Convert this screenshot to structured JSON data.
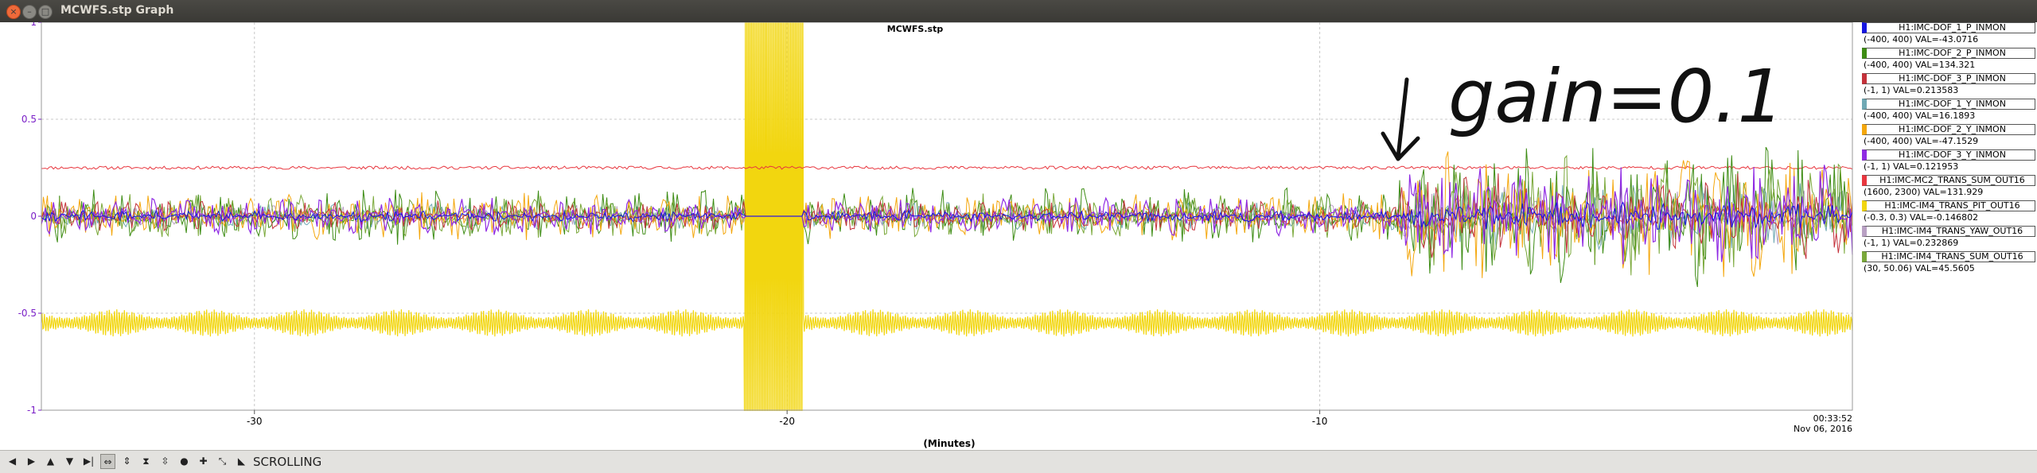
{
  "window": {
    "title": "MCWFS.stp Graph",
    "close_glyph": "×",
    "minimize_glyph": "–",
    "maximize_glyph": "□"
  },
  "chart_data": {
    "type": "line",
    "title": "MCWFS.stp",
    "xlabel": "(Minutes)",
    "ylabel": "",
    "xlim": [
      -34,
      0
    ],
    "ylim": [
      -1,
      1
    ],
    "x_ticks": [
      {
        "value": -30,
        "label": "-30"
      },
      {
        "value": -20,
        "label": "-20"
      },
      {
        "value": -10,
        "label": "-10"
      }
    ],
    "x_end_label": [
      "00:33:52",
      "Nov 06, 2016"
    ],
    "y_ticks": [
      {
        "value": 1,
        "label": "1"
      },
      {
        "value": 0.5,
        "label": "0.5"
      },
      {
        "value": 0,
        "label": "0"
      },
      {
        "value": -0.5,
        "label": "-0.5"
      },
      {
        "value": -1,
        "label": "-1"
      }
    ],
    "grid": true,
    "legend_position": "right",
    "annotation": {
      "text": "gain=0.1",
      "arrow": "down",
      "kind": "handwritten"
    },
    "series": [
      {
        "name": "H1:IMC-DOF_1_P_INMON",
        "range": "(-400, 400)",
        "value_text": "(-400, 400) VAL=-43.0716",
        "color": "#1515e0"
      },
      {
        "name": "H1:IMC-DOF_2_P_INMON",
        "range": "(-400, 400)",
        "value_text": "(-400, 400) VAL=134.321",
        "color": "#3d8c14"
      },
      {
        "name": "H1:IMC-DOF_3_P_INMON",
        "range": "(-1, 1)",
        "value_text": "(-1, 1) VAL=0.213583",
        "color": "#c4313a"
      },
      {
        "name": "H1:IMC-DOF_1_Y_INMON",
        "range": "(-400, 400)",
        "value_text": "(-400, 400) VAL=16.1893",
        "color": "#6fa8b4"
      },
      {
        "name": "H1:IMC-DOF_2_Y_INMON",
        "range": "(-400, 400)",
        "value_text": "(-400, 400) VAL=-47.1529",
        "color": "#f4a70d"
      },
      {
        "name": "H1:IMC-DOF_3_Y_INMON",
        "range": "(-1, 1)",
        "value_text": "(-1, 1) VAL=0.121953",
        "color": "#8f2ae3"
      },
      {
        "name": "H1:IMC-MC2_TRANS_SUM_OUT16",
        "range": "(1600, 2300)",
        "value_text": "(1600, 2300) VAL=131.929",
        "color": "#e8363e"
      },
      {
        "name": "H1:IMC-IM4_TRANS_PIT_OUT16",
        "range": "(-0.3, 0.3)",
        "value_text": "(-0.3, 0.3) VAL=-0.146802",
        "color": "#f2d60f"
      },
      {
        "name": "H1:IMC-IM4_TRANS_YAW_OUT16",
        "range": "(-1, 1)",
        "value_text": "(-1, 1) VAL=0.232869",
        "color": "#b9a1c4"
      },
      {
        "name": "H1:IMC-IM4_TRANS_SUM_OUT16",
        "range": "(30, 50.06)",
        "value_text": "(30, 50.06) VAL=45.5605",
        "color": "#7aa83a"
      }
    ],
    "approx_envelopes": {
      "gap_minutes": [
        -20.8,
        -19.7
      ],
      "gain_change_minute": -8.5,
      "mc2_trans_level": 0.25,
      "im4_pit_center": -0.55,
      "im4_pit_amplitude": 0.07,
      "noise_amp_before": 0.12,
      "noise_amp_after": 0.32
    }
  },
  "toolbar": {
    "buttons": [
      "◀",
      "▶",
      "▲",
      "▼",
      "▶|",
      "⇔",
      "⇕",
      "⧗",
      "⇳",
      "●",
      "✚",
      "⤡",
      "◣"
    ],
    "mode_label": "SCROLLING"
  }
}
